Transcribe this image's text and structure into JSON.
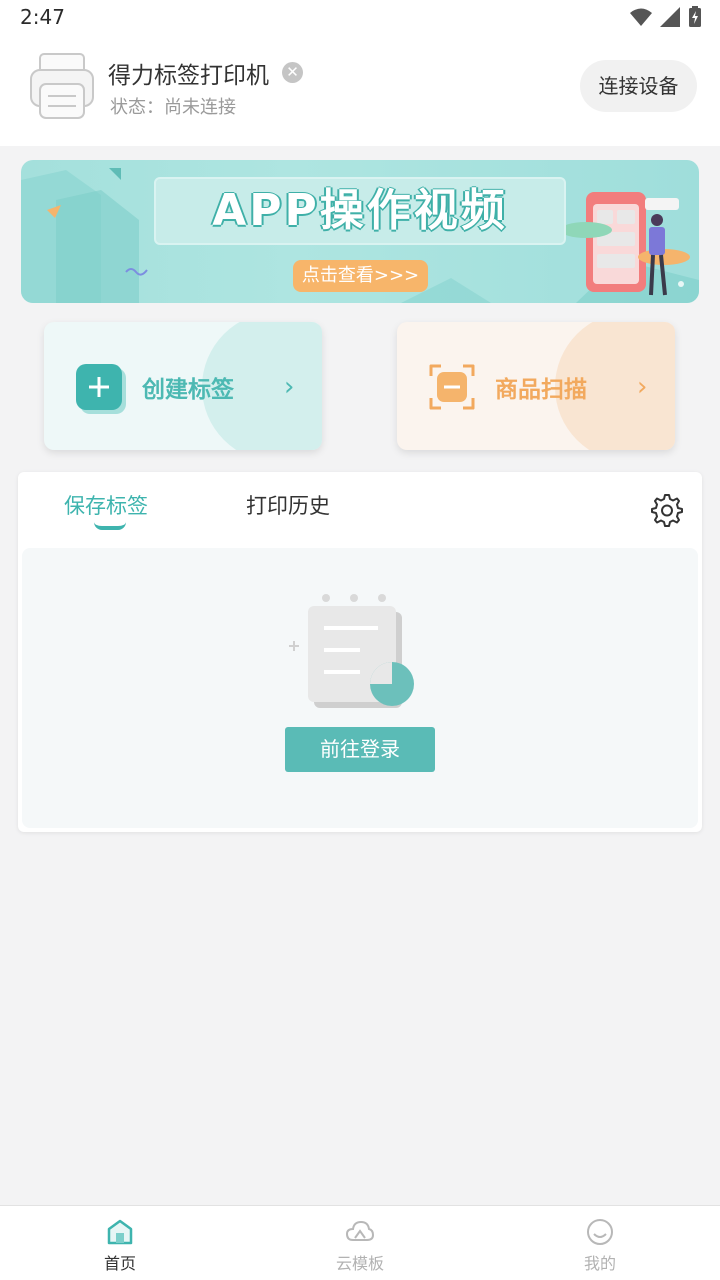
{
  "status_bar": {
    "time": "2:47"
  },
  "header": {
    "device_name": "得力标签打印机",
    "status_label": "状态：尚未连接",
    "connect_button": "连接设备"
  },
  "banner": {
    "title": "APP操作视频",
    "cta": "点击查看>>>"
  },
  "quick_actions": [
    {
      "label": "创建标签",
      "accent": "#4db9b3"
    },
    {
      "label": "商品扫描",
      "accent": "#f2a95e"
    }
  ],
  "tabs": [
    {
      "label": "保存标签",
      "active": true
    },
    {
      "label": "打印历史",
      "active": false
    }
  ],
  "empty_state": {
    "button": "前往登录"
  },
  "bottom_nav": [
    {
      "label": "首页",
      "icon": "home-icon",
      "active": true
    },
    {
      "label": "云模板",
      "icon": "cloud-icon",
      "active": false
    },
    {
      "label": "我的",
      "icon": "smile-icon",
      "active": false
    }
  ],
  "colors": {
    "accent": "#3eb4ae",
    "orange": "#f2a95e",
    "background": "#f3f3f4"
  }
}
